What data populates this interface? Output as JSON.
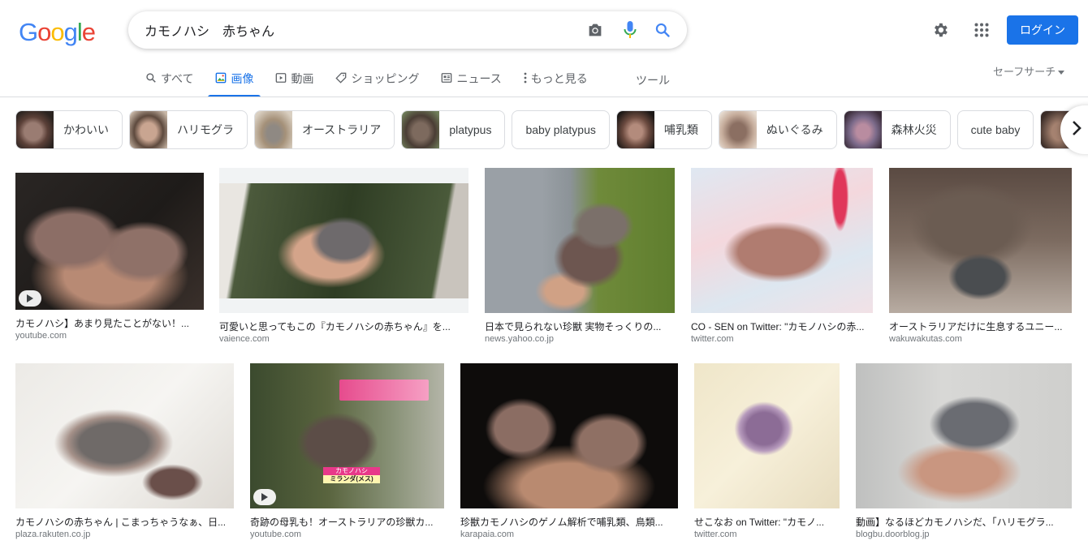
{
  "logo": {
    "letters": [
      "G",
      "o",
      "o",
      "g",
      "l",
      "e"
    ],
    "colors": [
      "#4285F4",
      "#EA4335",
      "#FBBC05",
      "#4285F4",
      "#34A853",
      "#EA4335"
    ]
  },
  "search": {
    "query": "カモノハシ　赤ちゃん",
    "icons": [
      "camera-icon",
      "mic-icon",
      "search-icon"
    ]
  },
  "header": {
    "login_label": "ログイン",
    "icons": [
      "gear-icon",
      "apps-grid-icon"
    ]
  },
  "tabs": [
    {
      "label": "すべて",
      "icon": "search-icon",
      "active": false
    },
    {
      "label": "画像",
      "icon": "image-icon",
      "active": true
    },
    {
      "label": "動画",
      "icon": "video-icon",
      "active": false
    },
    {
      "label": "ショッピング",
      "icon": "tag-icon",
      "active": false
    },
    {
      "label": "ニュース",
      "icon": "news-icon",
      "active": false
    },
    {
      "label": "もっと見る",
      "icon": "more-vert-icon",
      "active": false
    }
  ],
  "tools_label": "ツール",
  "safesearch_label": "セーフサーチ",
  "chips": [
    {
      "label": "かわいい",
      "thumb": true
    },
    {
      "label": "ハリモグラ",
      "thumb": true
    },
    {
      "label": "オーストラリア",
      "thumb": true
    },
    {
      "label": "platypus",
      "thumb": true
    },
    {
      "label": "baby platypus",
      "thumb": false
    },
    {
      "label": "哺乳類",
      "thumb": true
    },
    {
      "label": "ぬいぐるみ",
      "thumb": true
    },
    {
      "label": "森林火災",
      "thumb": true
    },
    {
      "label": "cute baby",
      "thumb": false
    }
  ],
  "results": [
    {
      "title": "カモノハシ】あまり見たことがない！...",
      "source": "youtube.com",
      "video": true
    },
    {
      "title": "可愛いと思ってもこの『カモノハシの赤ちゃん』を...",
      "source": "vaience.com",
      "video": false
    },
    {
      "title": "日本で見られない珍獣 実物そっくりの...",
      "source": "news.yahoo.co.jp",
      "video": false
    },
    {
      "title": "CO - SEN on Twitter: \"カモノハシの赤...",
      "source": "twitter.com",
      "video": false
    },
    {
      "title": "オーストラリアだけに生息するユニー...",
      "source": "wakuwakutas.com",
      "video": false
    },
    {
      "title": "カモノハシの赤ちゃん | こまっちゃうなぁ、日...",
      "source": "plaza.rakuten.co.jp",
      "video": false
    },
    {
      "title": "奇跡の母乳も！オーストラリアの珍獣カ...",
      "source": "youtube.com",
      "video": true
    },
    {
      "title": "珍獣カモノハシのゲノム解析で哺乳類、鳥類...",
      "source": "karapaia.com",
      "video": false
    },
    {
      "title": "せこなお on Twitter: \"カモノ...",
      "source": "twitter.com",
      "video": false
    },
    {
      "title": "動画】なるほどカモノハシだ、「ハリモグラ...",
      "source": "blogbu.doorblog.jp",
      "video": false
    }
  ],
  "overlay_caption": {
    "line1": "カモノハシ",
    "line2": "ミランダ(メス)"
  }
}
